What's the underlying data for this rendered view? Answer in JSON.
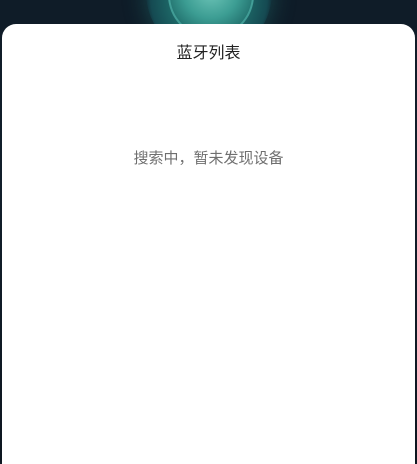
{
  "sheet": {
    "title": "蓝牙列表",
    "empty_message": "搜索中，暂未发现设备"
  },
  "colors": {
    "backdrop": "#101a24",
    "accent_glow": "#2c8e88",
    "sheet_background": "#ffffff",
    "title_text": "#222222",
    "message_text": "#6f6f6f"
  }
}
